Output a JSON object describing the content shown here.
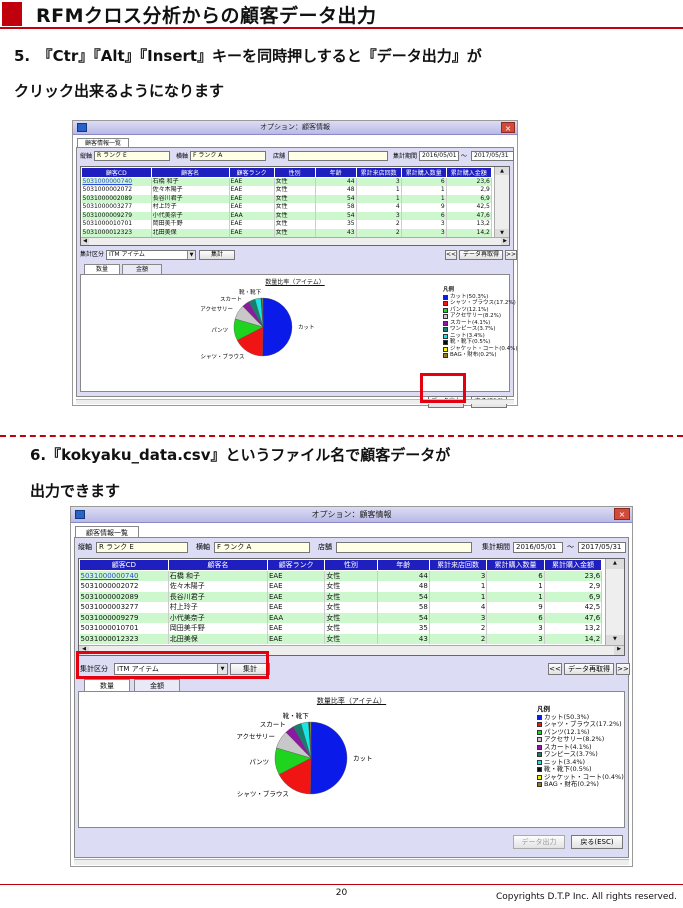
{
  "title": "RFMクロス分析からの顧客データ出力",
  "steps": {
    "step5_line1": "5.　『Ctr』『Alt』『Insert』キーを同時押しすると『データ出力』が",
    "step5_line2": "クリック出来るようになります",
    "step6_line1": "6.『kokyaku_data.csv』というファイル名で顧客データが",
    "step6_line2": "出力できます"
  },
  "window": {
    "title": "オプション：顧客情報",
    "app_icon": " ",
    "close_icon": "×",
    "tab": "顧客情報一覧",
    "filter": {
      "vertical_label": "縦軸",
      "vertical_value": "R ランク E",
      "horizontal_label": "横軸",
      "horizontal_value": "F ランク A",
      "store_label": "店舗",
      "store_value": "",
      "period_label": "集計期間",
      "period_from": "2016/05/01",
      "period_sep": "～",
      "period_to": "2017/05/31"
    },
    "grid": {
      "headers": [
        "顧客CD",
        "顧客名",
        "顧客ランク",
        "性別",
        "年齢",
        "累計来店回数",
        "累計購入数量",
        "累計購入金額"
      ],
      "rows": [
        [
          "5031000000740",
          "石橋 和子",
          "EAE",
          "女性",
          "44",
          "3",
          "6",
          "23,6"
        ],
        [
          "5031000002072",
          "佐々木陽子",
          "EAE",
          "女性",
          "48",
          "1",
          "1",
          "2,9"
        ],
        [
          "5031000002089",
          "長谷川君子",
          "EAE",
          "女性",
          "54",
          "1",
          "1",
          "6,9"
        ],
        [
          "5031000003277",
          "村上玲子",
          "EAE",
          "女性",
          "58",
          "4",
          "9",
          "42,5"
        ],
        [
          "5031000009279",
          "小代美奈子",
          "EAA",
          "女性",
          "54",
          "3",
          "6",
          "47,6"
        ],
        [
          "5031000010701",
          "岡田美千野",
          "EAE",
          "女性",
          "35",
          "2",
          "3",
          "13,2"
        ],
        [
          "5031000012323",
          "北田美保",
          "EAE",
          "女性",
          "43",
          "2",
          "3",
          "14,2"
        ]
      ],
      "scroll_up": "▲",
      "scroll_down": "▼",
      "scroll_left": "◀",
      "scroll_right": "▶"
    },
    "aggregation": {
      "label": "集計区分",
      "value": "ITM アイテム",
      "combo_arrow": "▼",
      "run_button": "集計",
      "prev_button": "<<",
      "refetch_button": "データ再取得",
      "next_button": ">>"
    },
    "subtabs": [
      "数量",
      "金額"
    ],
    "actions": {
      "export_button": "データ出力",
      "back_button": "戻る(ESC)"
    }
  },
  "chart_data": {
    "type": "pie",
    "title": "数量比率（アイテム）",
    "legend_title": "凡例",
    "legend_position": "right",
    "slices": [
      {
        "name": "カット",
        "value": 50.3,
        "legend": "カット(50.3%)",
        "color": "#0a1ae8"
      },
      {
        "name": "シャツ・ブラウス",
        "value": 17.2,
        "legend": "シャツ・ブラウス(17.2%)",
        "color": "#f01414"
      },
      {
        "name": "パンツ",
        "value": 12.1,
        "legend": "パンツ(12.1%)",
        "color": "#1ed41e"
      },
      {
        "name": "アクセサリー",
        "value": 8.2,
        "legend": "アクセサリー(8.2%)",
        "color": "#c8c8c8"
      },
      {
        "name": "スカート",
        "value": 4.1,
        "legend": "スカート(4.1%)",
        "color": "#8c1aa0"
      },
      {
        "name": "ワンピース",
        "value": 3.7,
        "legend": "ワンピース(3.7%)",
        "color": "#16806c"
      },
      {
        "name": "ニット",
        "value": 3.4,
        "legend": "ニット(3.4%)",
        "color": "#16e6e6"
      },
      {
        "name": "靴・靴下",
        "value": 0.5,
        "legend": "靴・靴下(0.5%)",
        "color": "#0a0a0a"
      },
      {
        "name": "ジャケット・コート",
        "value": 0.4,
        "legend": "ジャケット・コート(0.4%)",
        "color": "#f0f00a"
      },
      {
        "name": "BAG・財布",
        "value": 0.2,
        "legend": "BAG・財布(0.2%)",
        "color": "#9a7a20"
      }
    ],
    "labels_shown": [
      "カット",
      "シャツ・ブラウス",
      "パンツ",
      "アクセサリー",
      "スカート",
      "靴・靴下"
    ]
  },
  "footer": {
    "page_number": "20",
    "copyright": "Copyrights  D.T.P Inc. All rights reserved."
  },
  "colors": {
    "accent_red": "#c0000c",
    "highlight_red": "#e4000f",
    "grid_header": "#1f1fbf",
    "row_green": "#cdf7cd",
    "window_body": "#dcdcf4"
  }
}
